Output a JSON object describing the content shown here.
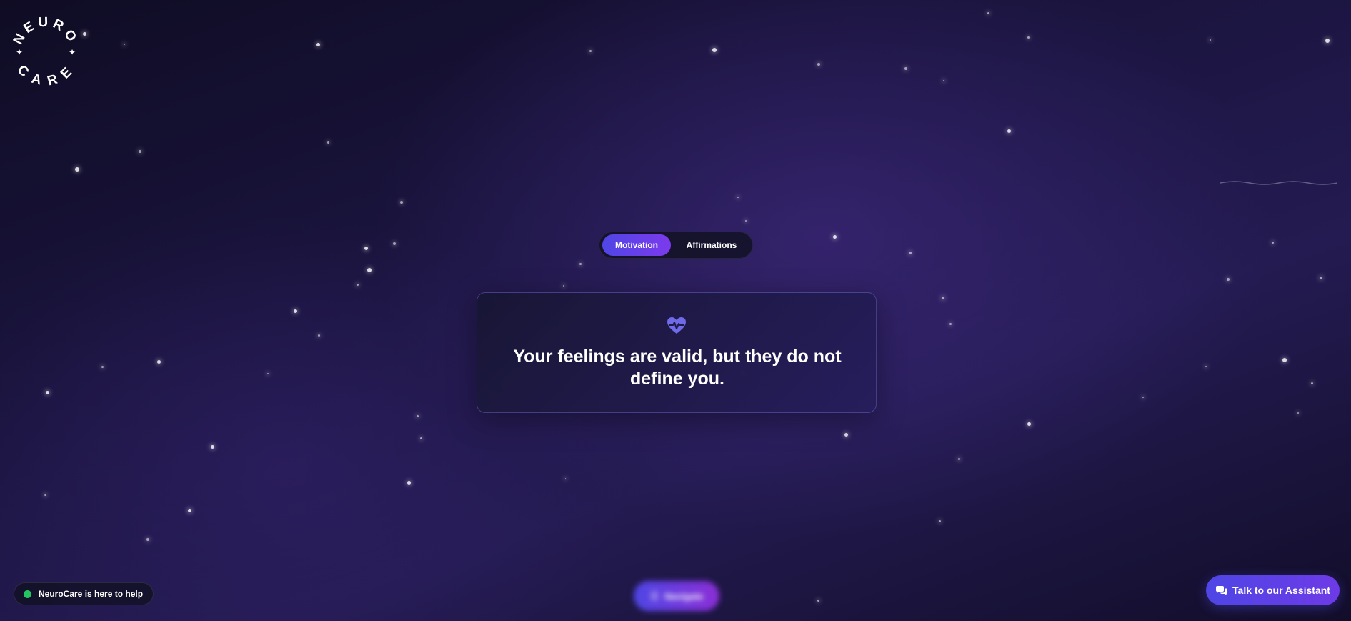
{
  "brand": {
    "logo_top": "NEURO",
    "logo_bottom": "CARE"
  },
  "tabs": [
    {
      "label": "Motivation",
      "active": true
    },
    {
      "label": "Affirmations",
      "active": false
    }
  ],
  "quote": {
    "icon": "heartbeat-icon",
    "text": "Your feelings are valid, but they do not define you."
  },
  "status": {
    "text": "NeuroCare is here to help",
    "indicator_color": "#22c55e"
  },
  "navigate": {
    "label": "Navigate",
    "icon": "menu-icon"
  },
  "assistant": {
    "label": "Talk to our Assistant",
    "icon": "chat-icon"
  },
  "colors": {
    "accent": "#4f46e5",
    "accent_2": "#7c3aed",
    "background": "#1b1540",
    "status_green": "#22c55e"
  }
}
